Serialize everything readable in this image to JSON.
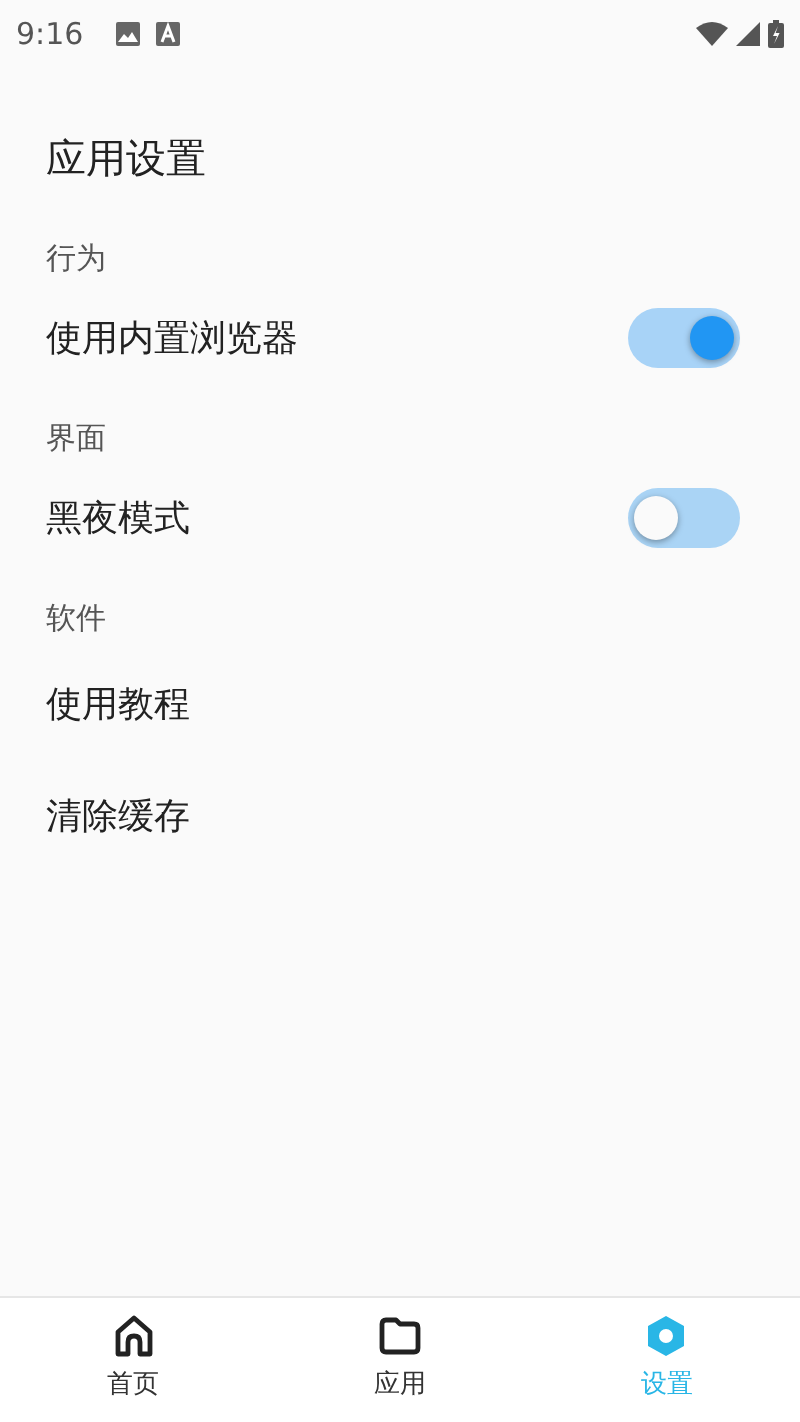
{
  "status_bar": {
    "time": "9:16"
  },
  "title": "应用设置",
  "items": [
    {
      "kind": "section",
      "label": "行为"
    },
    {
      "kind": "switch",
      "label": "使用内置浏览器",
      "on": true
    },
    {
      "kind": "section",
      "label": "界面"
    },
    {
      "kind": "switch",
      "label": "黑夜模式",
      "on": false
    },
    {
      "kind": "section",
      "label": "软件"
    },
    {
      "kind": "action",
      "label": "使用教程"
    },
    {
      "kind": "action",
      "label": "清除缓存"
    }
  ],
  "bottom_nav": [
    {
      "kind": "home",
      "label": "首页",
      "selected": false
    },
    {
      "kind": "apps",
      "label": "应用",
      "selected": false
    },
    {
      "kind": "settings",
      "label": "设置",
      "selected": true
    }
  ]
}
